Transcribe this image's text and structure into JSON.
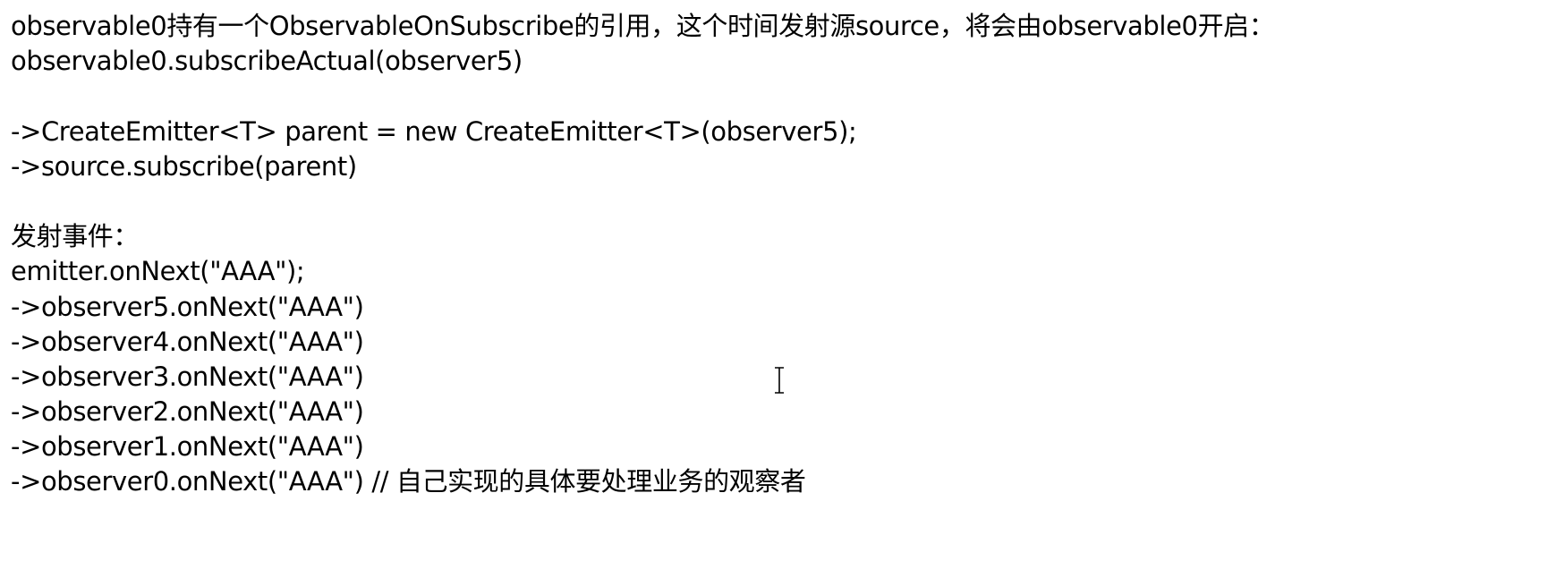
{
  "document": {
    "lines": [
      "observable0持有一个ObservableOnSubscribe的引用，这个时间发射源source，将会由observable0开启：",
      "observable0.subscribeActual(observer5)",
      "",
      "->CreateEmitter<T> parent = new CreateEmitter<T>(observer5);",
      "->source.subscribe(parent)",
      "",
      "发射事件：",
      "emitter.onNext(\"AAA\");",
      "->observer5.onNext(\"AAA\")",
      "->observer4.onNext(\"AAA\")",
      "->observer3.onNext(\"AAA\")",
      "->observer2.onNext(\"AAA\")",
      "->observer1.onNext(\"AAA\")",
      "->observer0.onNext(\"AAA\") // 自己实现的具体要处理业务的观察者"
    ]
  },
  "cursor": {
    "icon": "text-cursor-icon"
  }
}
